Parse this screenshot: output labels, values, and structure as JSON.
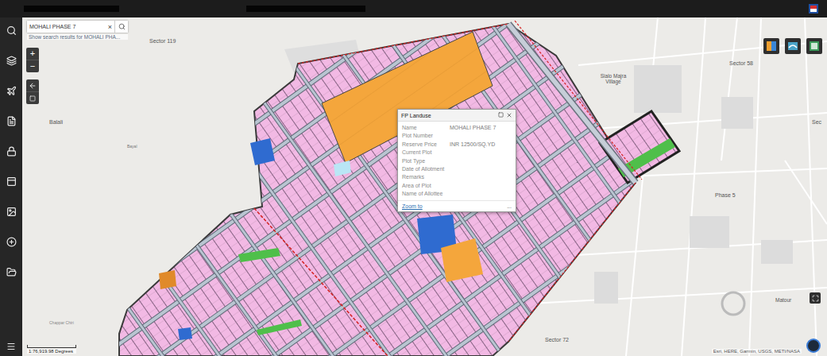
{
  "search": {
    "value": "MOHALI PHASE 7",
    "clear": "×",
    "hint": "Show search results for MOHALI PHA..."
  },
  "zoom": {
    "in": "+",
    "out": "−"
  },
  "map_labels": [
    {
      "text": "Sector 119"
    },
    {
      "text": "Balali"
    },
    {
      "text": "Bayal"
    },
    {
      "text": "Sector 58"
    },
    {
      "text": "Sialo Majra Village"
    },
    {
      "text": "Phase 5"
    },
    {
      "text": "Sector 72"
    },
    {
      "text": "Matour"
    },
    {
      "text": "Sec"
    },
    {
      "text": "Chappar Chiri"
    }
  ],
  "popup": {
    "title": "FP Landuse",
    "fields": [
      {
        "label": "Name",
        "value": "MOHALI PHASE 7"
      },
      {
        "label": "Plot Number",
        "value": ""
      },
      {
        "label": "Reserve Price",
        "value": "INR 12500/SQ.YD"
      },
      {
        "label": "Current Plot",
        "value": ""
      },
      {
        "label": "Plot Type",
        "value": ""
      },
      {
        "label": "Date of Allotment",
        "value": ""
      },
      {
        "label": "Remarks",
        "value": ""
      },
      {
        "label": "Area of Plot",
        "value": ""
      },
      {
        "label": "Name of Allottee",
        "value": ""
      }
    ],
    "link": "Zoom to",
    "more": "..."
  },
  "scale": "1:76,919.98 Degrees",
  "attribution": "Esri, HERE, Garmin, USGS, METI/NASA"
}
